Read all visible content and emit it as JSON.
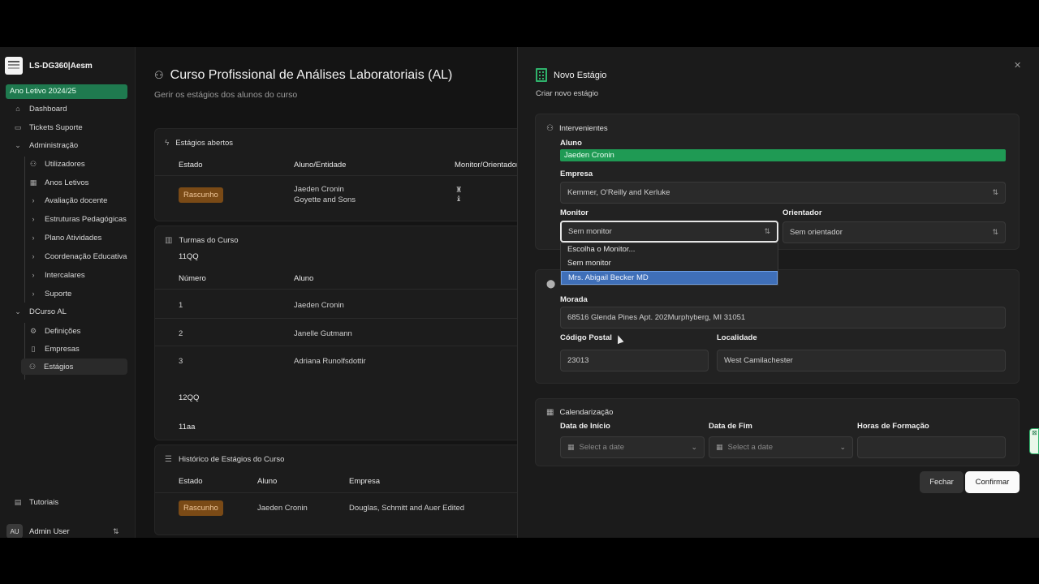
{
  "sidebar": {
    "brand": "LS-DG360|Aesm",
    "school_year": "Ano Letivo 2024/25",
    "items": [
      {
        "label": "Dashboard",
        "icon": "home-icon"
      },
      {
        "label": "Tickets Suporte",
        "icon": "ticket-icon"
      },
      {
        "label": "Administração",
        "icon": "chevron-down-icon"
      },
      {
        "label": "Utilizadores",
        "icon": "users-icon"
      },
      {
        "label": "Anos Letivos",
        "icon": "calendar-icon"
      },
      {
        "label": "Avaliação docente",
        "icon": "chevron-right-icon"
      },
      {
        "label": "Estruturas Pedagógicas",
        "icon": "chevron-right-icon"
      },
      {
        "label": "Plano Atividades",
        "icon": "chevron-right-icon"
      },
      {
        "label": "Coordenação Educativa",
        "icon": "chevron-right-icon"
      },
      {
        "label": "Intercalares",
        "icon": "chevron-right-icon"
      },
      {
        "label": "Suporte",
        "icon": "chevron-right-icon"
      },
      {
        "label": "DCurso AL",
        "icon": "chevron-down-icon"
      },
      {
        "label": "Definições",
        "icon": "gear-icon"
      },
      {
        "label": "Empresas",
        "icon": "building-icon"
      },
      {
        "label": "Estágios",
        "icon": "users-icon"
      }
    ],
    "tutorials": "Tutoriais",
    "user": {
      "initials": "AU",
      "name": "Admin User"
    }
  },
  "main": {
    "title": "Curso Profissional de Análises Laboratoriais (AL)",
    "subtitle": "Gerir os estágios dos alunos do curso",
    "open": {
      "title": "Estágios abertos",
      "headers": [
        "Estado",
        "Aluno/Entidade",
        "Monitor/Orientador"
      ],
      "row": {
        "status": "Rascunho",
        "student": "Jaeden Cronin",
        "entity": "Goyette and Sons"
      }
    },
    "classes": {
      "title": "Turmas do Curso",
      "group1": "11QQ",
      "headers": [
        "Número",
        "Aluno"
      ],
      "rows": [
        {
          "n": "1",
          "name": "Jaeden Cronin"
        },
        {
          "n": "2",
          "name": "Janelle Gutmann"
        },
        {
          "n": "3",
          "name": "Adriana Runolfsdottir"
        }
      ],
      "group2": "12QQ",
      "group3": "11aa"
    },
    "history": {
      "title": "Histórico de Estágios do Curso",
      "headers": [
        "Estado",
        "Aluno",
        "Empresa"
      ],
      "row": {
        "status": "Rascunho",
        "student": "Jaeden Cronin",
        "company": "Douglas, Schmitt and Auer Edited"
      }
    }
  },
  "dialog": {
    "title": "Novo Estágio",
    "subtitle": "Criar novo estágio",
    "participants": {
      "title": "Intervenientes",
      "student_label": "Aluno",
      "student_value": "Jaeden Cronin",
      "company_label": "Empresa",
      "company_value": "Kemmer, O'Reilly and Kerluke",
      "monitor_label": "Monitor",
      "monitor_value": "Sem monitor",
      "advisor_label": "Orientador",
      "advisor_value": "Sem orientador",
      "monitor_options": [
        "Escolha o Monitor...",
        "Sem monitor",
        "Mrs. Abigail Becker MD"
      ]
    },
    "location": {
      "address_label": "Morada",
      "address_value": "68516 Glenda Pines Apt. 202Murphyberg, MI 31051",
      "postal_label": "Código Postal",
      "postal_value": "23013",
      "city_label": "Localidade",
      "city_value": "West Camilachester"
    },
    "schedule": {
      "title": "Calendarização",
      "start_label": "Data de Início",
      "start_placeholder": "Select a date",
      "end_label": "Data de Fim",
      "end_placeholder": "Select a date",
      "hours_label": "Horas de Formação",
      "hours_value": ""
    },
    "close_label": "Fechar",
    "confirm_label": "Confirmar"
  }
}
